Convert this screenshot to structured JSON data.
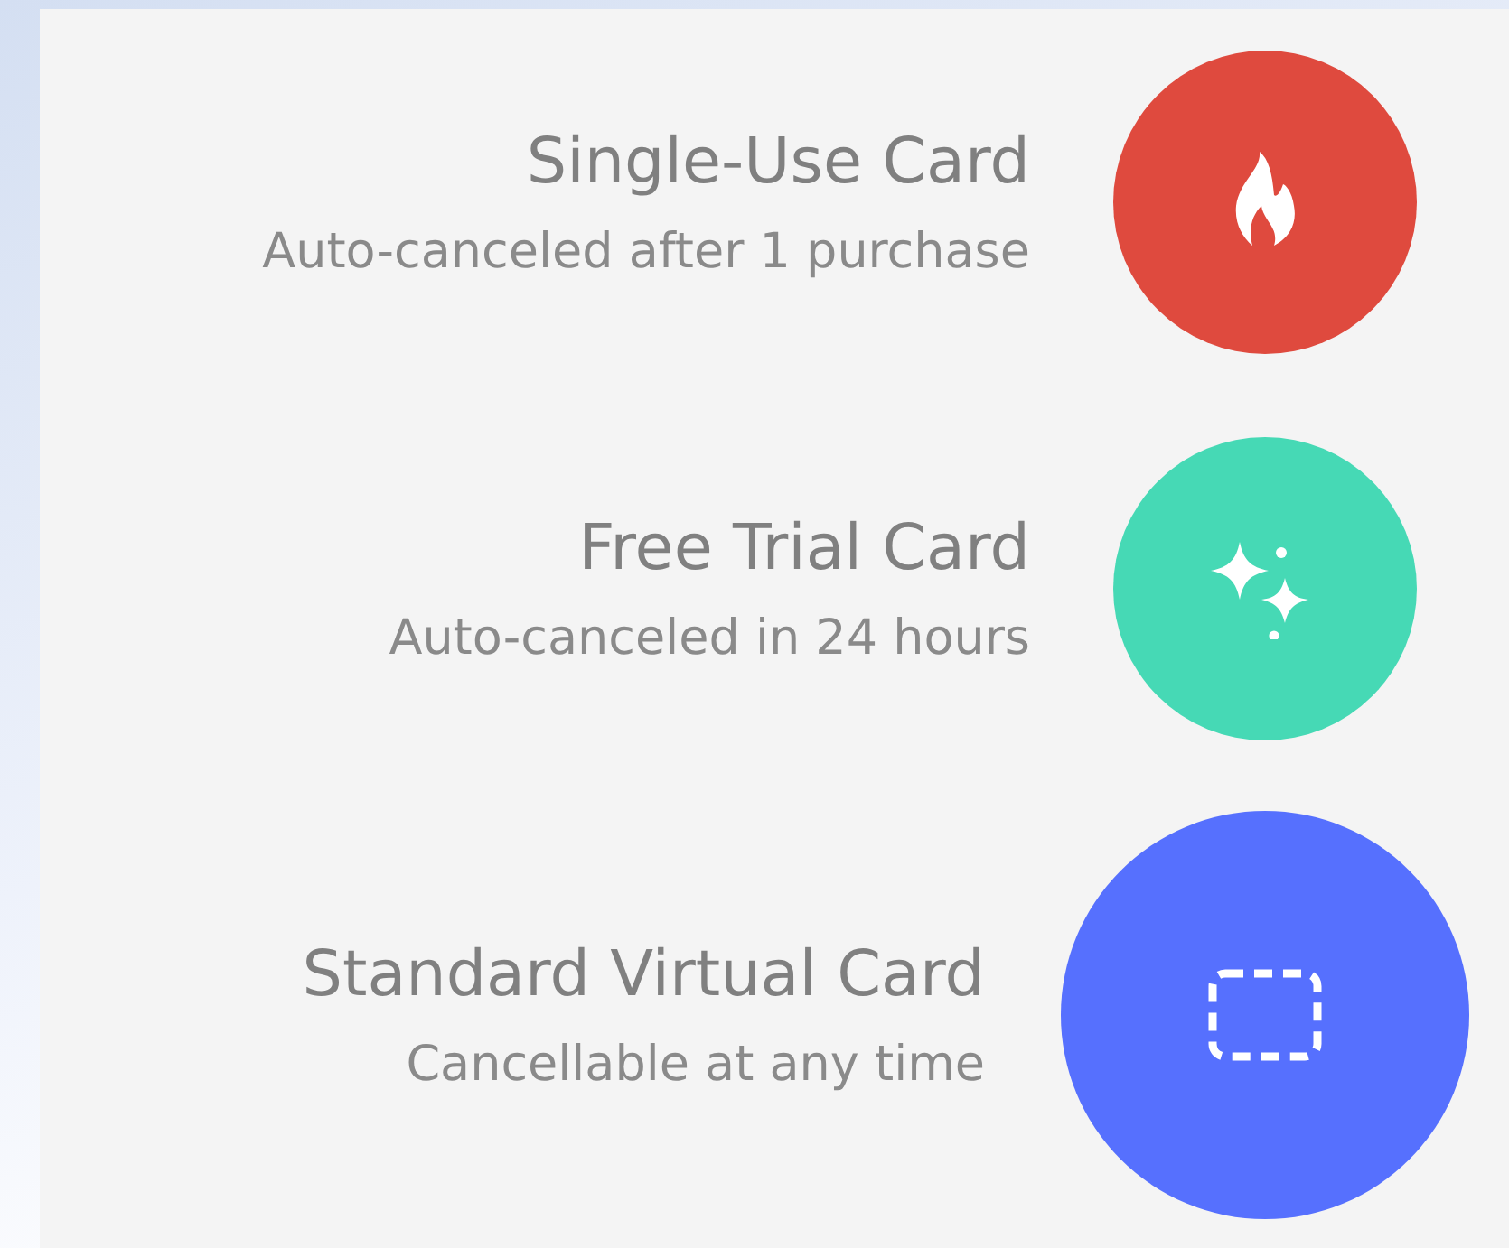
{
  "cards": [
    {
      "title": "Single-Use Card",
      "subtitle": "Auto-canceled after 1 purchase",
      "kind": "fire",
      "color": "#df4a3e"
    },
    {
      "title": "Free Trial Card",
      "subtitle": "Auto-canceled in 24 hours",
      "kind": "sparkle",
      "color": "#46d9b5"
    },
    {
      "title": "Standard Virtual Card",
      "subtitle": "Cancellable at any time",
      "kind": "dashed",
      "color": "#5670fe"
    }
  ]
}
